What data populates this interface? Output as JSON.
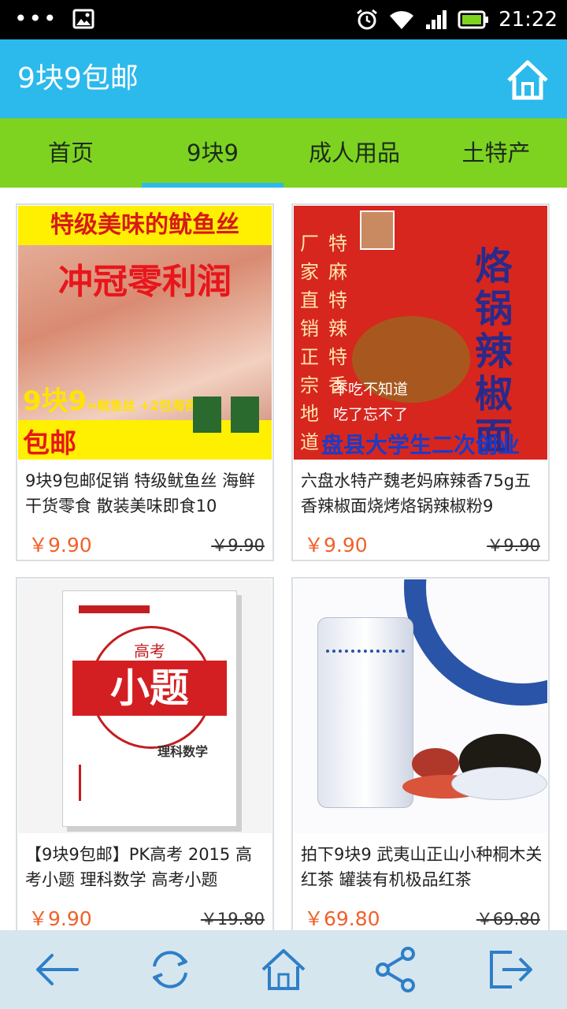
{
  "status_bar": {
    "time": "21:22"
  },
  "header": {
    "title": "9块9包邮"
  },
  "tabs": [
    {
      "label": "首页"
    },
    {
      "label": "9块9"
    },
    {
      "label": "成人用品"
    },
    {
      "label": "土特产"
    }
  ],
  "active_tab": "9块9",
  "products": [
    {
      "name": "9块9包邮促销 特级鱿鱼丝 海鲜干货零食 散装美味即食10",
      "price": "￥9.90",
      "old_price": "￥9.90",
      "image_text": {
        "line1": "特级美味的鱿鱼丝",
        "line2": "冲冠零利润",
        "line3": "9块9",
        "line3b": "=鱿鱼丝 +2包海苔",
        "line4": "包邮"
      }
    },
    {
      "name": "六盘水特产魏老妈麻辣香75g五香辣椒面烧烤烙锅辣椒粉9",
      "price": "￥9.90",
      "old_price": "￥9.90",
      "image_text": {
        "col1": "厂家直销正宗地道",
        "col2": "特麻特辣特香",
        "big": "烙锅辣椒面",
        "slogan1": "不吃不知道",
        "slogan2": "吃了忘不了",
        "banner": "盘县大学生二次创业"
      }
    },
    {
      "name": "【9块9包邮】PK高考 2015 高考小题 理科数学 高考小题",
      "price": "￥9.90",
      "old_price": "￥19.80",
      "image_text": {
        "top": "高考",
        "big": "小题",
        "sub": "理科数学"
      }
    },
    {
      "name": "拍下9块9 武夷山正山小种桐木关红茶 罐装有机极品红茶",
      "price": "￥69.80",
      "old_price": "￥69.80"
    }
  ],
  "bottom_nav": [
    "back-icon",
    "refresh-icon",
    "home-icon",
    "share-icon",
    "exit-icon"
  ],
  "colors": {
    "header": "#2cb9ec",
    "tabs": "#7ed321",
    "price": "#f0622a",
    "bottom_bar": "#d6e6ef"
  }
}
